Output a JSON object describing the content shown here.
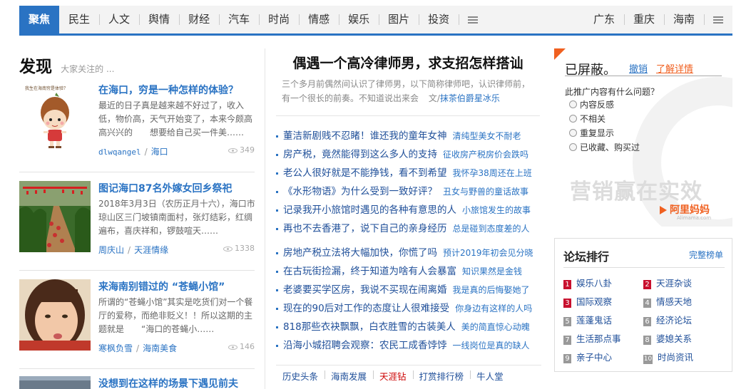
{
  "nav": {
    "left": [
      "聚焦",
      "民生",
      "人文",
      "舆情",
      "财经",
      "汽车",
      "时尚",
      "情感",
      "娱乐",
      "图片",
      "投资"
    ],
    "active_index": 0,
    "right": [
      "广东",
      "重庆",
      "海南"
    ],
    "menu_icon": "menu-icon"
  },
  "discover": {
    "title": "发现",
    "subtitle": "大家关注的 ...",
    "thumb1_text": "我生在海南穷是体验？",
    "articles": [
      {
        "title": "在海口，穷是一种怎样的体验？",
        "desc": "最近的日子真是越来越不好过了，收入低，物价高，天气开始变了，本来今颇高高兴兴的　　想要给自己买一件美……",
        "author": "dlwqangel",
        "board": "海口",
        "views": "349"
      },
      {
        "title": "图记海口87名外嫁女回乡祭祀",
        "desc": "2018年3月3日（农历正月十六），海口市琼山区三门坡镇南面村，张灯结彩，红绸遍布，喜庆祥和，锣鼓喧天……",
        "author": "周庆山",
        "board": "天涯情缘",
        "views": "1338"
      },
      {
        "title": "来海南别错过的 “苍蝇小馆”",
        "desc": "所谓的“苍蝇小馆”其实是吃货们对一个餐厅的爱称，而绝非贬义！！所以这期的主题就是　　“海口的苍蝇小……",
        "author": "寒枫负雪",
        "board": "海南美食",
        "views": "146"
      },
      {
        "title": "没想到在这样的场景下遇见前夫",
        "desc": "",
        "author": "",
        "board": "",
        "views": ""
      }
    ]
  },
  "featured": {
    "title": "偶遇一个高冷律师男，求支招怎样搭讪",
    "intro": "三个多月前偶然间认识了律师男，以下简称律师吧，认识律师前，有一个很长的前奏。不知道说出来会",
    "author_prefix": "文/",
    "author": "抹茶伯爵星冰乐"
  },
  "news_group1": [
    {
      "main": "董洁新剧贱不忍睹！谁还我的童年女神",
      "side": "清纯型美女不耐老",
      "red": false
    },
    {
      "main": "房产税，竟然能得到这么多人的支持",
      "side": "征收房产税房价会跌吗",
      "red": false
    },
    {
      "main": "老公人很好就是不能挣钱，看不到希望",
      "side": "我怀孕38周还在上班",
      "red": false
    },
    {
      "main": "《水形物语》为什么受到一致好评？",
      "side": "丑女与野兽的童话故事",
      "red": false
    },
    {
      "main": "记录我开小旅馆时遇见的各种有意思的人",
      "side": "小旅馆发生的故事",
      "red": false
    },
    {
      "main": "再也不去香港了，说下自己的亲身经历",
      "side": "总是碰到态度差的人",
      "red": false
    }
  ],
  "news_group2": [
    {
      "main": "房地产税立法将大幅加快，你慌了吗",
      "side": "预计2019年初会见分晓",
      "red": false
    },
    {
      "main": "在古玩街捡漏，终于知道为啥有人会暴富",
      "side": "知识果然是金钱",
      "red": false
    },
    {
      "main": "老婆要买学区房，我说不买现在闹离婚",
      "side": "我是真的后悔娶她了",
      "red": false
    },
    {
      "main": "现在的90后对工作的态度让人很难接受",
      "side": "你身边有这样的人吗",
      "red": false
    },
    {
      "main": "818那些衣袂飘飘，白衣胜雪的古装美人",
      "side": "美的简直惊心动魄",
      "red": false
    },
    {
      "main": "沿海小城招聘会观察：农民工成香饽饽",
      "side": "一线岗位是真的缺人",
      "red": false
    }
  ],
  "bottom_links": [
    {
      "label": "历史头条",
      "red": false
    },
    {
      "label": "海南发展",
      "red": false
    },
    {
      "label": "天涯钻",
      "red": true
    },
    {
      "label": "打赏排行榜",
      "red": false
    },
    {
      "label": "牛人堂",
      "red": false
    }
  ],
  "ad": {
    "blocked": "已屏蔽。",
    "undo": "撤销",
    "learn_more": "了解详情",
    "question": "此推广内容有什么问题？",
    "options": [
      "内容反感",
      "不相关",
      "重复显示",
      "已收藏、购买过"
    ],
    "watermark": "营销赢在实效",
    "brand": "阿里妈妈",
    "brand_sub": "Alimama.com",
    "accent": "#f06020"
  },
  "forum": {
    "title": "论坛排行",
    "all": "完整榜单",
    "items": [
      {
        "n": "1",
        "label": "娱乐八卦"
      },
      {
        "n": "2",
        "label": "天涯杂谈"
      },
      {
        "n": "3",
        "label": "国际观察"
      },
      {
        "n": "4",
        "label": "情感天地"
      },
      {
        "n": "5",
        "label": "莲蓬鬼话"
      },
      {
        "n": "6",
        "label": "经济论坛"
      },
      {
        "n": "7",
        "label": "生活那点事"
      },
      {
        "n": "8",
        "label": "婆媳关系"
      },
      {
        "n": "9",
        "label": "亲子中心"
      },
      {
        "n": "10",
        "label": "时尚资讯"
      }
    ]
  },
  "colors": {
    "accent": "#2a73c3",
    "link": "#1f4f99",
    "hot": "#c8102e"
  }
}
